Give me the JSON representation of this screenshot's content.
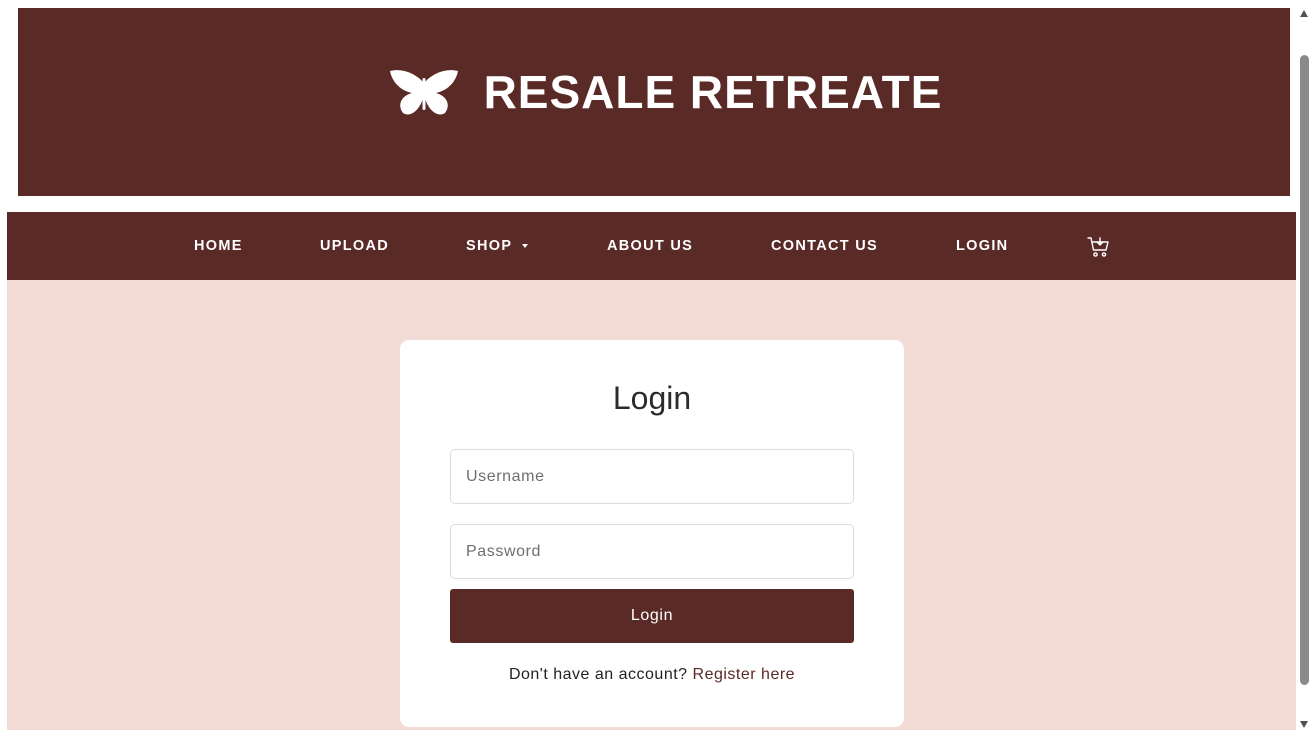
{
  "header": {
    "logo_text": "RESALE RETREATE",
    "logo_icon": "butterfly-icon"
  },
  "nav": {
    "home": "HOME",
    "upload": "UPLOAD",
    "shop": "SHOP",
    "about": "ABOUT US",
    "contact": "CONTACT US",
    "login": "LOGIN",
    "cart_icon": "cart-icon"
  },
  "login_form": {
    "title": "Login",
    "username_placeholder": "Username",
    "password_placeholder": "Password",
    "username_value": "",
    "password_value": "",
    "submit_label": "Login",
    "register_prompt": "Don't have an account?",
    "register_link": "Register here"
  },
  "colors": {
    "brand": "#5a2a27",
    "background": "#f2dad5",
    "card": "#ffffff"
  }
}
